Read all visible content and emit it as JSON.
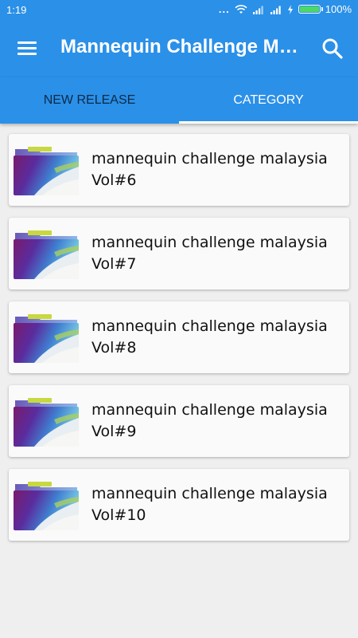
{
  "status_bar": {
    "time": "1:19",
    "dots": "...",
    "battery_percent": "100%"
  },
  "app_bar": {
    "title": "Mannequin Challenge Malaysia",
    "menu_icon": "hamburger-menu-icon",
    "search_icon": "search-icon",
    "color": "#2b90e8"
  },
  "tabs": [
    {
      "label": "NEW RELEASE",
      "active": false
    },
    {
      "label": "CATEGORY",
      "active": true
    }
  ],
  "items": [
    {
      "title": "mannequin challenge malaysia Vol#6"
    },
    {
      "title": "mannequin challenge malaysia Vol#7"
    },
    {
      "title": "mannequin challenge malaysia Vol#8"
    },
    {
      "title": "mannequin challenge malaysia Vol#9"
    },
    {
      "title": "mannequin challenge malaysia Vol#10"
    }
  ]
}
